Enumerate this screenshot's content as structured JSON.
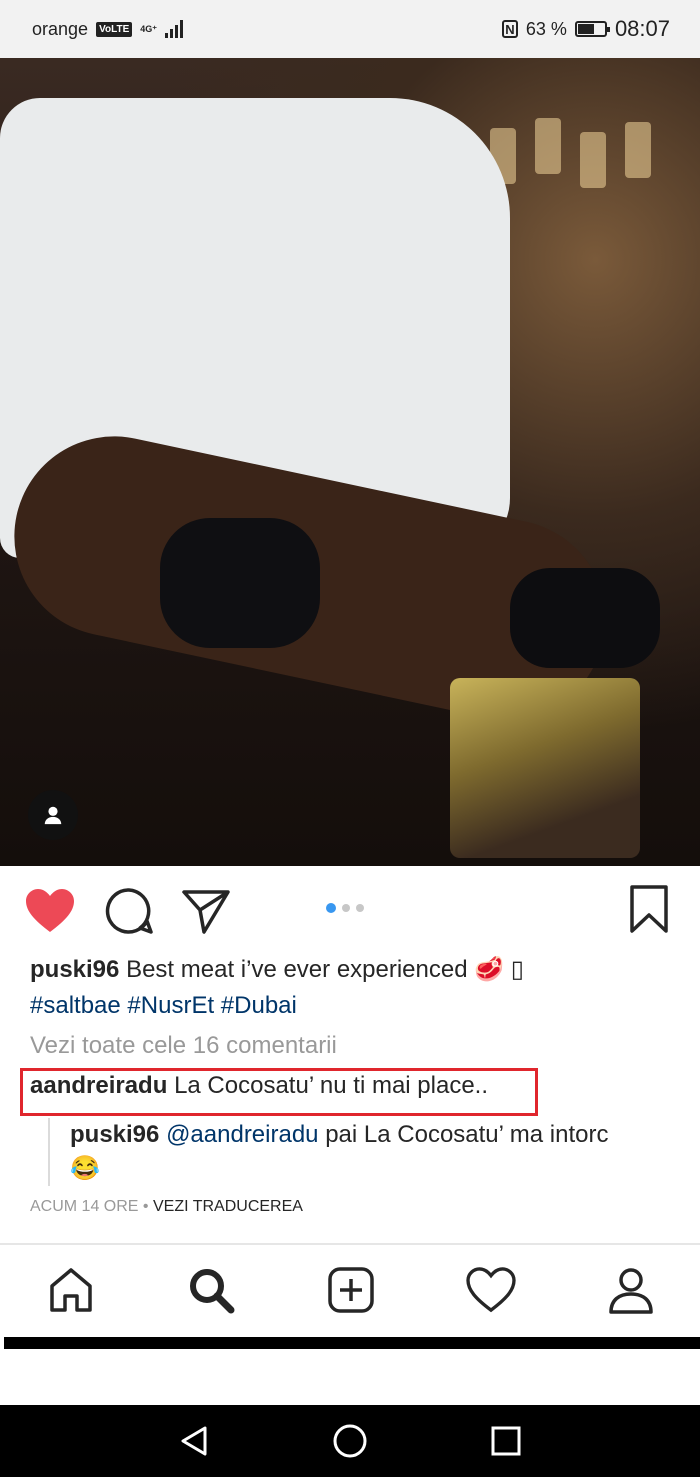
{
  "status_bar": {
    "carrier": "orange",
    "volte": "VoLTE",
    "network": "4G⁺",
    "battery_text": "63 %",
    "battery_level": 0.63,
    "time": "08:07"
  },
  "post": {
    "media_dots_total": 3,
    "media_dots_active": 1,
    "caption_user": "puski96",
    "caption_text": "Best meat i’ve ever experienced 🥩 ",
    "caption_missing_glyph": "▯",
    "hashtags": [
      "#saltbae",
      "#NusrEt",
      "#Dubai"
    ],
    "view_all_comments": "Vezi toate cele 16 comentarii",
    "comment_user": "aandreiradu",
    "comment_text": "La Cocosatu’ nu ti mai place..",
    "reply_user": "puski96",
    "reply_mention": "@aandreiradu",
    "reply_text": "pai La Cocosatu’ ma intorc",
    "reply_emoji": "😂",
    "time_ago": "ACUM 14 ORE",
    "separator": "•",
    "see_translation": "VEZI TRADUCEREA"
  },
  "colors": {
    "like_red": "#ed4956",
    "hashtag_blue": "#003569",
    "active_dot": "#3897f0",
    "highlight_box": "#e0262d"
  },
  "icons": {
    "actions": [
      "heart-filled-icon",
      "comment-icon",
      "share-icon",
      "bookmark-icon"
    ],
    "tabs": [
      "home-icon",
      "search-icon",
      "add-post-icon",
      "activity-heart-icon",
      "profile-icon"
    ],
    "system_nav": [
      "back-icon",
      "home-circle-icon",
      "recents-icon"
    ]
  }
}
